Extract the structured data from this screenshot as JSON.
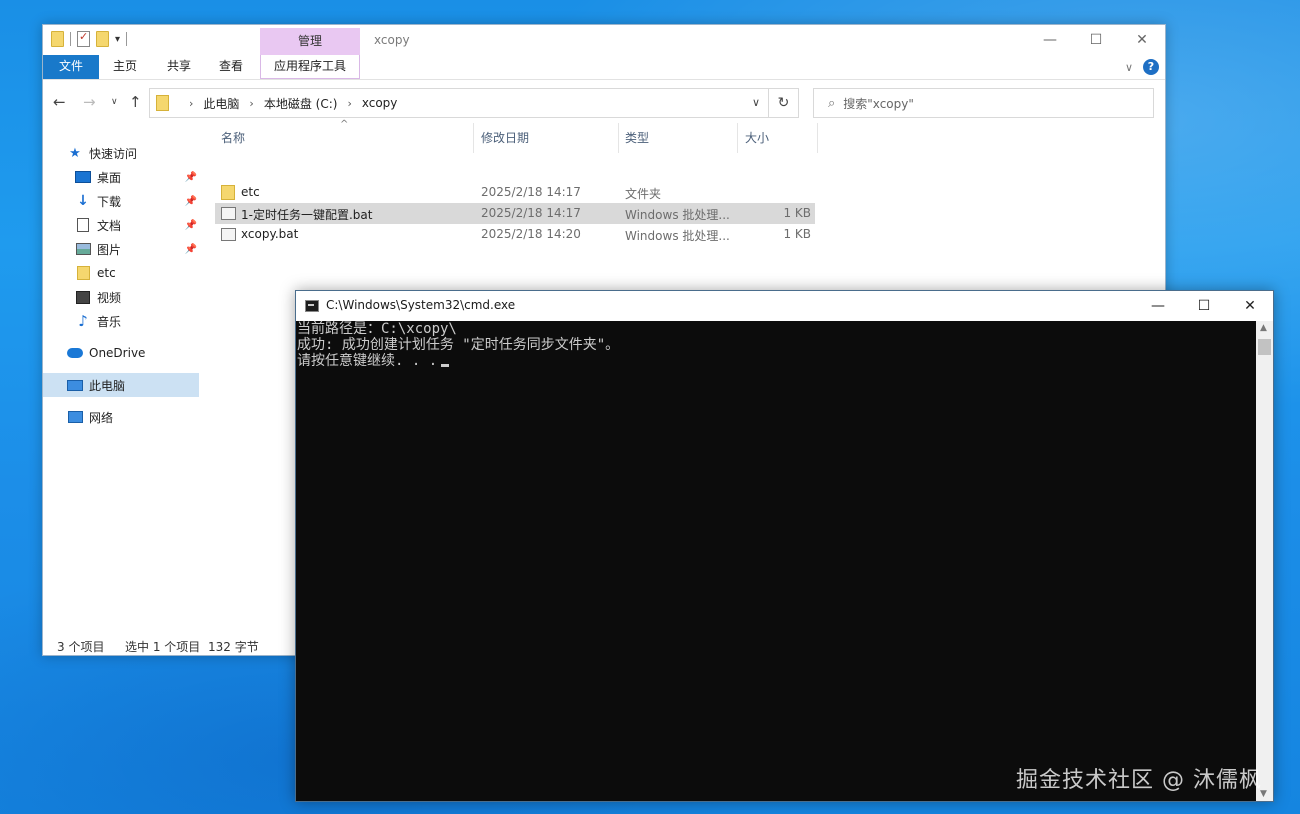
{
  "explorer": {
    "window_title": "xcopy",
    "manage_tab": "管理",
    "ribbon_tabs": {
      "file": "文件",
      "home": "主页",
      "share": "共享",
      "view": "查看",
      "app_tools": "应用程序工具"
    },
    "breadcrumbs": [
      "此电脑",
      "本地磁盘 (C:)",
      "xcopy"
    ],
    "search_placeholder": "搜索\"xcopy\"",
    "sidebar": {
      "quick_access": "快速访问",
      "items": [
        {
          "label": "桌面",
          "icon": "desktop-icon",
          "pinned": true
        },
        {
          "label": "下载",
          "icon": "download-icon",
          "pinned": true
        },
        {
          "label": "文档",
          "icon": "document-icon",
          "pinned": true
        },
        {
          "label": "图片",
          "icon": "pictures-icon",
          "pinned": true
        },
        {
          "label": "etc",
          "icon": "folder-icon",
          "pinned": false
        },
        {
          "label": "视频",
          "icon": "video-icon",
          "pinned": false
        },
        {
          "label": "音乐",
          "icon": "music-icon",
          "pinned": false
        }
      ],
      "onedrive": "OneDrive",
      "this_pc": "此电脑",
      "network": "网络"
    },
    "columns": {
      "name": "名称",
      "modified": "修改日期",
      "type": "类型",
      "size": "大小"
    },
    "files": [
      {
        "name": "etc",
        "modified": "2025/2/18 14:17",
        "type": "文件夹",
        "size": "",
        "icon": "folder-icon",
        "selected": false
      },
      {
        "name": "1-定时任务一键配置.bat",
        "modified": "2025/2/18 14:17",
        "type": "Windows 批处理...",
        "size": "1 KB",
        "icon": "batch-file-icon",
        "selected": true
      },
      {
        "name": "xcopy.bat",
        "modified": "2025/2/18 14:20",
        "type": "Windows 批处理...",
        "size": "1 KB",
        "icon": "batch-file-icon",
        "selected": false
      }
    ],
    "status": {
      "item_count": "3 个项目",
      "selected": "选中 1 个项目",
      "size": "132 字节"
    }
  },
  "cmd": {
    "title": "C:\\Windows\\System32\\cmd.exe",
    "lines": [
      "当前路径是：C:\\xcopy\\",
      "成功: 成功创建计划任务 \"定时任务同步文件夹\"。",
      "请按任意键继续. . ."
    ]
  },
  "watermark": "掘金技术社区 @ 沐儒枫",
  "colors": {
    "accent": "#1979ca",
    "manage_tab": "#e9c8f2",
    "selection": "#cce1f3",
    "cmd_bg": "#0c0c0c",
    "cmd_text": "#cccccc"
  }
}
